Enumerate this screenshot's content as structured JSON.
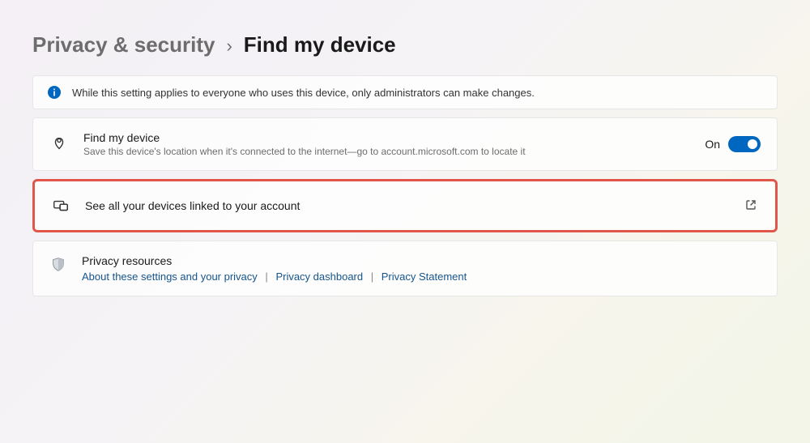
{
  "breadcrumb": {
    "parent": "Privacy & security",
    "separator": "›",
    "current": "Find my device"
  },
  "infoBanner": {
    "text": "While this setting applies to everyone who uses this device, only administrators can make changes."
  },
  "findMyDevice": {
    "title": "Find my device",
    "description": "Save this device's location when it's connected to the internet—go to account.microsoft.com to locate it",
    "toggleLabel": "On",
    "toggleState": true
  },
  "linkedDevices": {
    "label": "See all your devices linked to your account"
  },
  "resources": {
    "title": "Privacy resources",
    "links": [
      "About these settings and your privacy",
      "Privacy dashboard",
      "Privacy Statement"
    ],
    "separator": "|"
  }
}
